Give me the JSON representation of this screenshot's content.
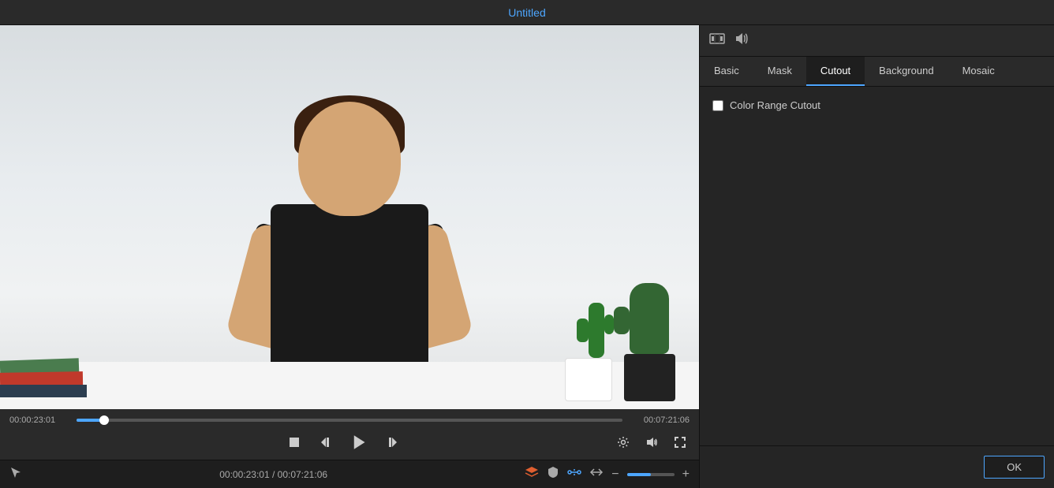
{
  "window": {
    "title": "Untitled"
  },
  "tabs": {
    "items": [
      "Basic",
      "Mask",
      "Cutout",
      "Background",
      "Mosaic"
    ],
    "active": "Cutout"
  },
  "cutout": {
    "checkbox_label": "Color Range Cutout",
    "checkbox_checked": false
  },
  "controls": {
    "time_current": "00:00:23:01",
    "time_total": "00:07:21:06",
    "time_display": "00:00:23:01 / 00:07:21:06",
    "progress_percent": 5,
    "stop_label": "Stop",
    "step_back_label": "Step Back",
    "play_label": "Play",
    "step_forward_label": "Step Forward",
    "ok_label": "OK"
  },
  "icons": {
    "film": "🎬",
    "audio": "🔊",
    "settings": "⚙",
    "volume": "🔊",
    "fullscreen": "⛶",
    "cursor": "↖",
    "shield": "🛡",
    "connect": "⇌",
    "loop": "↔",
    "zoom_out": "−",
    "zoom_in": "+"
  }
}
